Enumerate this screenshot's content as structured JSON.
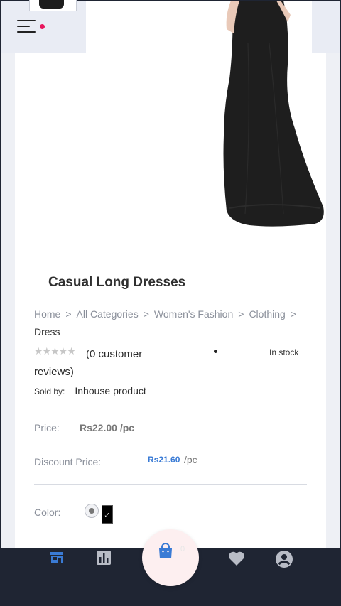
{
  "product": {
    "title": "Casual Long Dresses",
    "breadcrumb": [
      "Home",
      "All Categories",
      "Women's Fashion",
      "Clothing",
      "Dress"
    ],
    "breadcrumb_separator": ">",
    "rating": {
      "stars": "★★★★★",
      "filled_fraction": 0,
      "reviews_text": "(0 customer reviews)"
    },
    "stock_status": "In stock",
    "sold_by_label": "Sold by:",
    "sold_by_value": "Inhouse product",
    "price_label": "Price:",
    "price_original": "Rs22.00 /pc",
    "discount_label": "Discount Price:",
    "discount_price": "Rs21.60",
    "discount_unit": "/pc",
    "color_label": "Color:",
    "colors": [
      {
        "name": "grey",
        "value": "#777777",
        "selected": false
      },
      {
        "name": "black",
        "value": "#000000",
        "selected": true
      }
    ]
  },
  "nav": {
    "items": [
      {
        "icon": "store-icon",
        "active": true
      },
      {
        "icon": "bar-chart-icon",
        "active": false
      },
      {
        "icon": "shopping-bag-icon",
        "active": false,
        "badge": "0"
      },
      {
        "icon": "heart-icon",
        "active": false
      },
      {
        "icon": "account-icon",
        "active": false
      }
    ]
  },
  "colors": {
    "accent": "#3a7bd5",
    "nav_background": "#1f2533",
    "notification_dot": "#e8175d",
    "fab_background": "#fdeff0"
  }
}
